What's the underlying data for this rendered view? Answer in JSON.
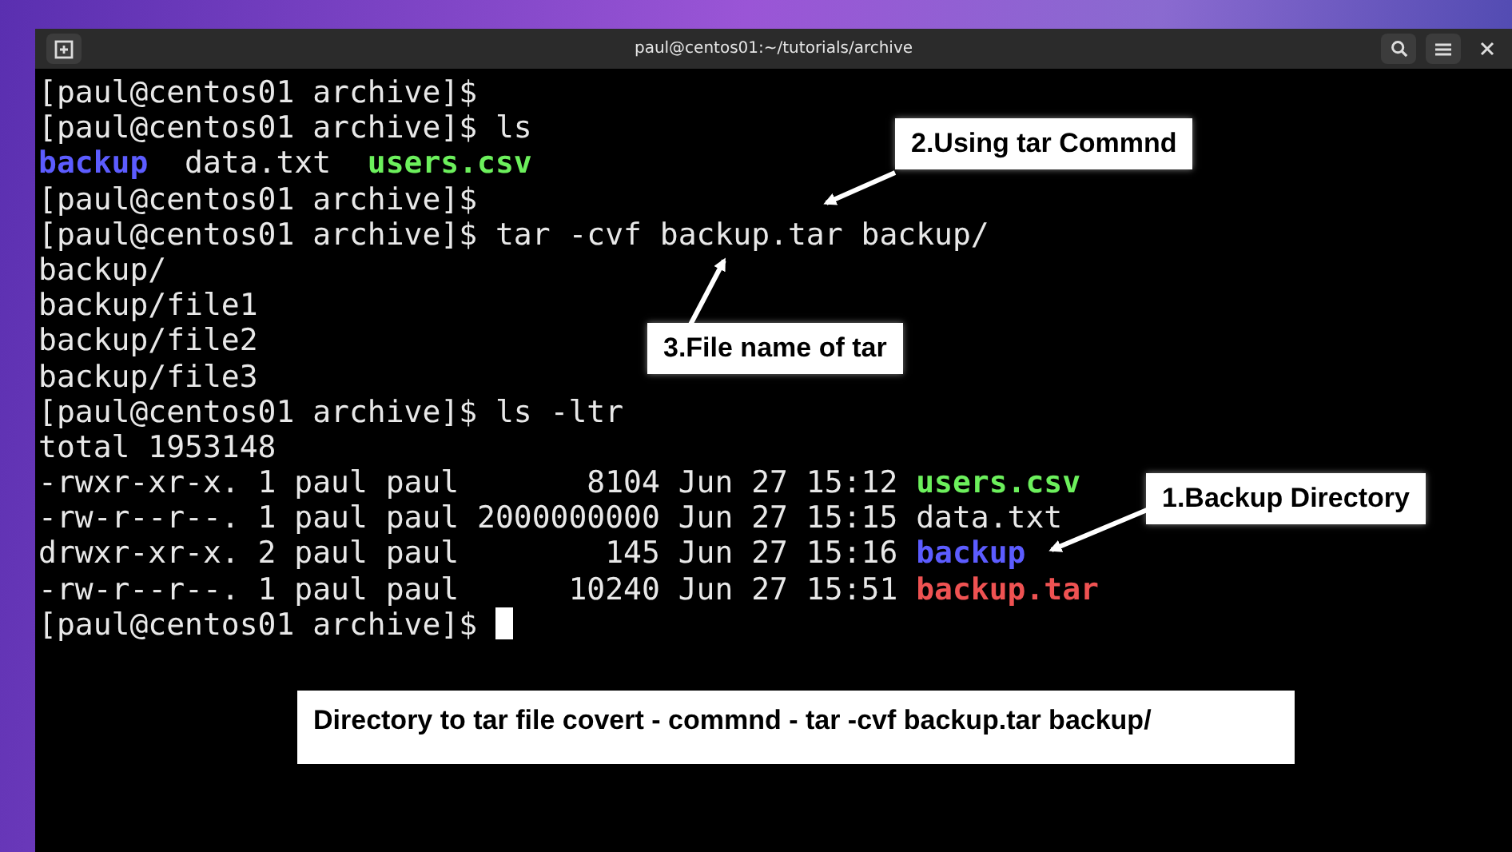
{
  "window": {
    "title": "paul@centos01:~/tutorials/archive"
  },
  "terminal": {
    "lines": [
      [
        {
          "text": "[paul@centos01 archive]$",
          "kind": "plain"
        }
      ],
      [
        {
          "text": "[paul@centos01 archive]$ ls",
          "kind": "plain"
        }
      ],
      [
        {
          "text": "backup",
          "kind": "dir"
        },
        {
          "text": "  data.txt  ",
          "kind": "plain"
        },
        {
          "text": "users.csv",
          "kind": "exec"
        }
      ],
      [
        {
          "text": "[paul@centos01 archive]$",
          "kind": "plain"
        }
      ],
      [
        {
          "text": "[paul@centos01 archive]$ tar -cvf backup.tar backup/",
          "kind": "plain"
        }
      ],
      [
        {
          "text": "backup/",
          "kind": "plain"
        }
      ],
      [
        {
          "text": "backup/file1",
          "kind": "plain"
        }
      ],
      [
        {
          "text": "backup/file2",
          "kind": "plain"
        }
      ],
      [
        {
          "text": "backup/file3",
          "kind": "plain"
        }
      ],
      [
        {
          "text": "[paul@centos01 archive]$ ls -ltr",
          "kind": "plain"
        }
      ],
      [
        {
          "text": "total 1953148",
          "kind": "plain"
        }
      ],
      [
        {
          "text": "-rwxr-xr-x. 1 paul paul       8104 Jun 27 15:12 ",
          "kind": "plain"
        },
        {
          "text": "users.csv",
          "kind": "exec"
        }
      ],
      [
        {
          "text": "-rw-r--r--. 1 paul paul 2000000000 Jun 27 15:15 data.txt",
          "kind": "plain"
        }
      ],
      [
        {
          "text": "drwxr-xr-x. 2 paul paul        145 Jun 27 15:16 ",
          "kind": "plain"
        },
        {
          "text": "backup",
          "kind": "dir"
        }
      ],
      [
        {
          "text": "-rw-r--r--. 1 paul paul      10240 Jun 27 15:51 ",
          "kind": "plain"
        },
        {
          "text": "backup.tar",
          "kind": "archive"
        }
      ],
      [
        {
          "text": "[paul@centos01 archive]$ ",
          "kind": "plain"
        }
      ]
    ],
    "cursor": true
  },
  "annotations": [
    {
      "text": "2.Using tar Commnd"
    },
    {
      "text": "3.File name of tar"
    },
    {
      "text": "1.Backup Directory"
    }
  ],
  "caption": "Directory to tar file covert - commnd - tar -cvf backup.tar backup/"
}
